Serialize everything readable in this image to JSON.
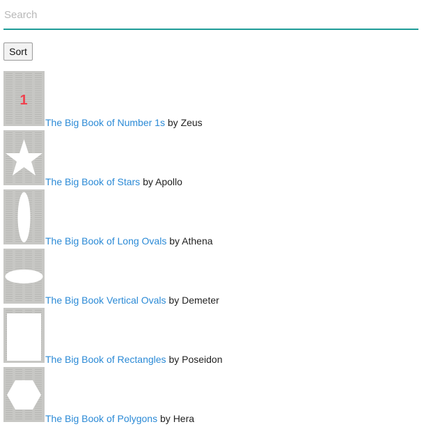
{
  "search": {
    "placeholder": "Search",
    "value": ""
  },
  "sort_label": "Sort",
  "by_word": "by",
  "books": [
    {
      "title": "The Big Book of Number 1s",
      "author": "Zeus",
      "cover_icon": "number-one",
      "cover_text": "1"
    },
    {
      "title": "The Big Book of Stars",
      "author": "Apollo",
      "cover_icon": "star"
    },
    {
      "title": "The Big Book of Long Ovals",
      "author": "Athena",
      "cover_icon": "vertical-oval"
    },
    {
      "title": "The Big Book Vertical Ovals",
      "author": "Demeter",
      "cover_icon": "horizontal-oval"
    },
    {
      "title": "The Big Book of Rectangles",
      "author": "Poseidon",
      "cover_icon": "rectangle"
    },
    {
      "title": "The Big Book of Polygons",
      "author": "Hera",
      "cover_icon": "hexagon"
    }
  ],
  "colors": {
    "accent": "#1e9c98",
    "link": "#2b8ad6",
    "cover_bg": "#c7c7c4",
    "number_red": "#f0424f"
  }
}
